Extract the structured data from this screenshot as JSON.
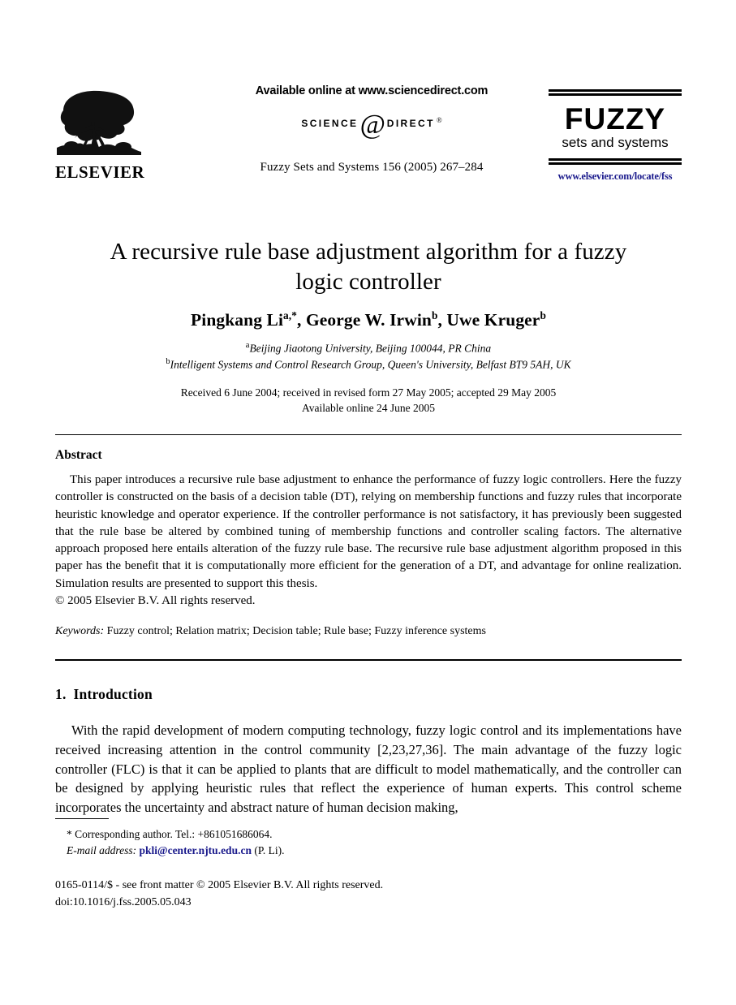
{
  "masthead": {
    "publisher_logo_name": "elsevier-tree-logo",
    "publisher_wordmark": "ELSEVIER",
    "available_online": "Available online at www.sciencedirect.com",
    "sciencedirect_left": "SCIENCE",
    "sciencedirect_at": "@",
    "sciencedirect_right": "DIRECT",
    "sciencedirect_reg": "®",
    "journal_reference": "Fuzzy Sets and Systems  156 (2005) 267–284",
    "journal_logo_title": "FUZZY",
    "journal_logo_subtitle": "sets and systems",
    "journal_url": "www.elsevier.com/locate/fss"
  },
  "title_block": {
    "title_line1": "A recursive rule base adjustment algorithm for a fuzzy",
    "title_line2": "logic controller",
    "authors": {
      "a1_name": "Pingkang Li",
      "a1_marks": "a,*",
      "sep1": ", ",
      "a2_name": "George W. Irwin",
      "a2_marks": "b",
      "sep2": ", ",
      "a3_name": "Uwe Kruger",
      "a3_marks": "b"
    },
    "affiliation_a_mark": "a",
    "affiliation_a": "Beijing Jiaotong University, Beijing 100044, PR China",
    "affiliation_b_mark": "b",
    "affiliation_b": "Intelligent Systems and Control Research Group, Queen's University, Belfast BT9 5AH, UK",
    "dates_line1": "Received 6 June 2004; received in revised form 27 May 2005; accepted 29 May 2005",
    "dates_line2": "Available online 24 June 2005"
  },
  "abstract": {
    "heading": "Abstract",
    "body": "This paper introduces a recursive rule base adjustment to enhance the performance of fuzzy logic controllers. Here the fuzzy controller is constructed on the basis of a decision table (DT), relying on membership functions and fuzzy rules that incorporate heuristic knowledge and operator experience. If the controller performance is not satisfactory, it has previously been suggested that the rule base be altered by combined tuning of membership functions and controller scaling factors. The alternative approach proposed here entails alteration of the fuzzy rule base. The recursive rule base adjustment algorithm proposed in this paper has the benefit that it is computationally more efficient for the generation of a DT, and advantage for online realization. Simulation results are presented to support this thesis.",
    "copyright": "© 2005 Elsevier B.V. All rights reserved.",
    "keywords_label": "Keywords:",
    "keywords_text": "Fuzzy control; Relation matrix; Decision table; Rule base; Fuzzy inference systems"
  },
  "introduction": {
    "number": "1.",
    "heading": "Introduction",
    "body": "With the rapid development of modern computing technology, fuzzy logic control and its implementations have received increasing attention in the control community [2,23,27,36]. The main advantage of the fuzzy logic controller (FLC) is that it can be applied to plants that are difficult to model mathematically, and the controller can be designed by applying heuristic rules that reflect the experience of human experts. This control scheme incorporates the uncertainty and abstract nature of human decision making,"
  },
  "footnotes": {
    "corresponding": "* Corresponding author. Tel.: +861051686064.",
    "email_label": "E-mail address:",
    "email_address": "pkli@center.njtu.edu.cn",
    "email_suffix": "(P. Li).",
    "imprint_line1": "0165-0114/$ - see front matter © 2005 Elsevier B.V. All rights reserved.",
    "imprint_line2": "doi:10.1016/j.fss.2005.05.043"
  },
  "colors": {
    "link": "#1a1a8c",
    "text": "#000000",
    "background": "#ffffff"
  }
}
